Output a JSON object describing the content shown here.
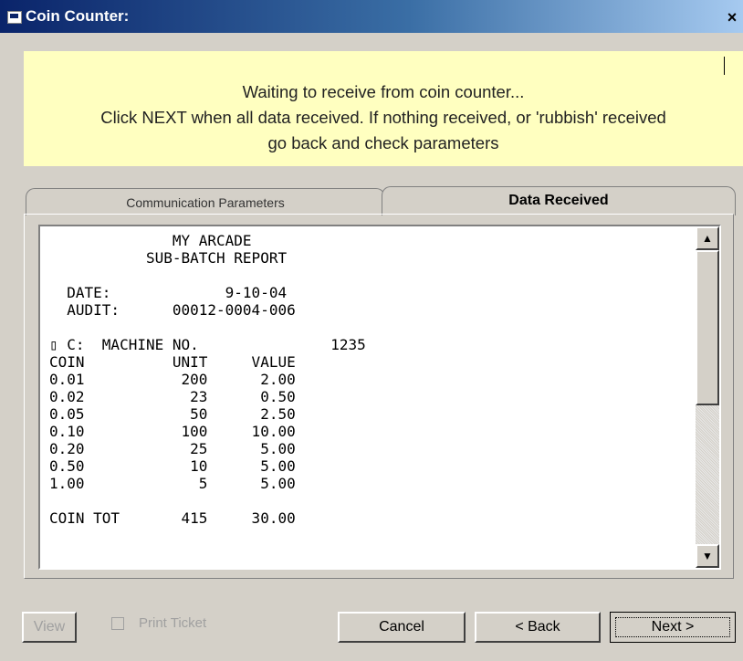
{
  "window": {
    "title": "Coin Counter:",
    "close_label": "×"
  },
  "banner": {
    "line1": "Waiting to receive from coin counter...",
    "line2": "Click NEXT when all data received. If nothing received, or 'rubbish' received",
    "line3": "go back and check parameters"
  },
  "tabs": [
    {
      "label": "Communication Parameters",
      "active": false
    },
    {
      "label": "Data Received",
      "active": true
    }
  ],
  "report": {
    "lines": [
      "              MY ARCADE",
      "           SUB-BATCH REPORT",
      "",
      "  DATE:             9-10-04",
      "  AUDIT:      00012-0004-006",
      "",
      "▯ C:  MACHINE NO.               1235",
      "COIN          UNIT     VALUE",
      "0.01           200      2.00",
      "0.02            23      0.50",
      "0.05            50      2.50",
      "0.10           100     10.00",
      "0.20            25      5.00",
      "0.50            10      5.00",
      "1.00             5      5.00",
      "",
      "COIN TOT       415     30.00"
    ]
  },
  "buttons": {
    "view": "View",
    "print_ticket": "Print Ticket",
    "cancel": "Cancel",
    "back": "< Back",
    "next": "Next >"
  }
}
